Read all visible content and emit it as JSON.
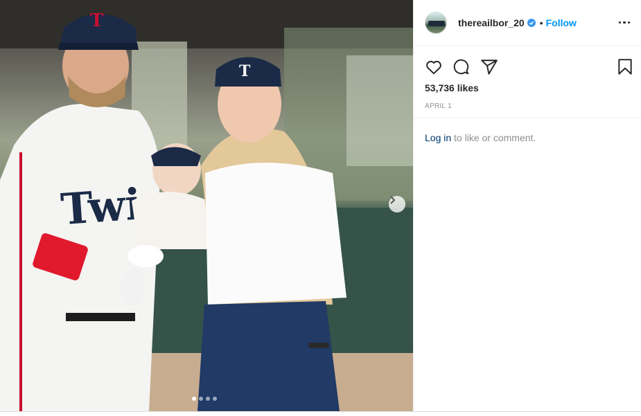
{
  "post": {
    "username": "thereailbor_20",
    "separator": "•",
    "follow_label": "Follow",
    "likes": "53,736 likes",
    "date": "APRIL 1",
    "login_link": "Log in",
    "login_rest": " to like or comment."
  },
  "carousel": {
    "slide_count": 4,
    "active_slide": 1
  },
  "icons": {
    "like": "heart-icon",
    "comment": "comment-icon",
    "share": "share-icon",
    "save": "bookmark-icon",
    "more": "more-options-icon",
    "next": "chevron-right-icon",
    "verified": "verified-badge-icon"
  },
  "colors": {
    "accent": "#0095f6",
    "link": "#00376b",
    "muted": "#8e8e8e",
    "text": "#262626"
  }
}
